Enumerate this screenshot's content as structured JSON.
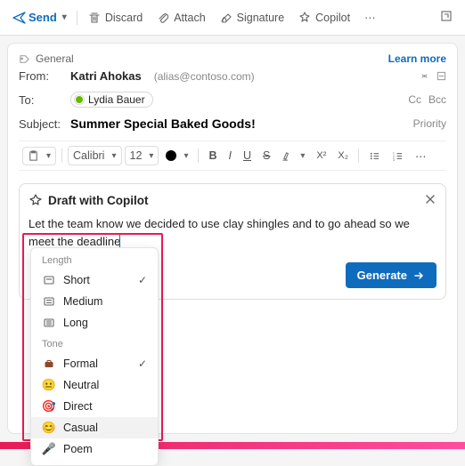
{
  "toolbar": {
    "send": "Send",
    "discard": "Discard",
    "attach": "Attach",
    "signature": "Signature",
    "copilot": "Copilot"
  },
  "tag": {
    "label": "General",
    "learn_more": "Learn more"
  },
  "from": {
    "label": "From:",
    "name": "Katri Ahokas",
    "alias": "(alias@contoso.com)"
  },
  "to": {
    "label": "To:",
    "recipient": "Lydia Bauer",
    "cc": "Cc",
    "bcc": "Bcc"
  },
  "subject": {
    "label": "Subject:",
    "value": "Summer Special Baked Goods!",
    "priority": "Priority"
  },
  "format": {
    "font": "Calibri",
    "size": "12"
  },
  "copilot_panel": {
    "title": "Draft with Copilot",
    "prompt": "Let the team know we decided to use clay shingles and to go ahead so we meet the deadline",
    "generate": "Generate"
  },
  "menu": {
    "length_label": "Length",
    "tone_label": "Tone",
    "length": {
      "short": "Short",
      "medium": "Medium",
      "long": "Long"
    },
    "tone": {
      "formal": "Formal",
      "neutral": "Neutral",
      "direct": "Direct",
      "casual": "Casual",
      "poem": "Poem"
    },
    "selected_length": "Short",
    "selected_tone": "Formal"
  }
}
